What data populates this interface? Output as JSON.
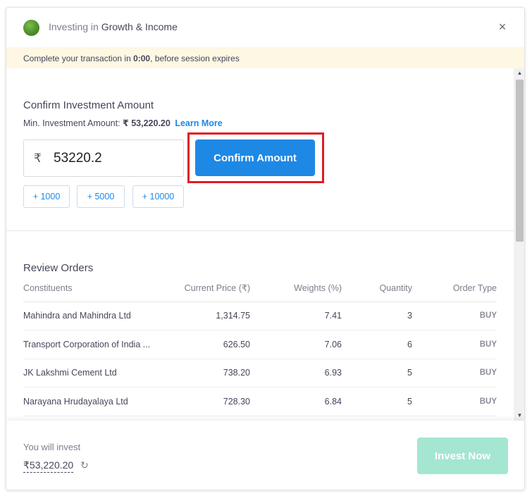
{
  "header": {
    "title_prefix": "Investing in",
    "title_name": "Growth & Income",
    "close_symbol": "×"
  },
  "banner": {
    "text_before": "Complete your transaction in ",
    "time": "0:00",
    "text_after": ", before session expires"
  },
  "confirm": {
    "title": "Confirm Investment Amount",
    "min_label": "Min. Investment Amount: ",
    "min_amount": "₹ 53,220.20",
    "learn_more": "Learn More",
    "currency_symbol": "₹",
    "amount_value": "53220.2",
    "button_label": "Confirm Amount",
    "chips": [
      "+ 1000",
      "+ 5000",
      "+ 10000"
    ]
  },
  "review": {
    "title": "Review Orders",
    "columns": [
      "Constituents",
      "Current Price (₹)",
      "Weights (%)",
      "Quantity",
      "Order Type"
    ],
    "rows": [
      [
        "Mahindra and Mahindra Ltd",
        "1,314.75",
        "7.41",
        "3",
        "BUY"
      ],
      [
        "Transport Corporation of India ...",
        "626.50",
        "7.06",
        "6",
        "BUY"
      ],
      [
        "JK Lakshmi Cement Ltd",
        "738.20",
        "6.93",
        "5",
        "BUY"
      ],
      [
        "Narayana Hrudayalaya Ltd",
        "728.30",
        "6.84",
        "5",
        "BUY"
      ]
    ]
  },
  "footer": {
    "invest_label": "You will invest",
    "invest_amount": "₹53,220.20",
    "invest_button": "Invest Now"
  },
  "colors": {
    "primary": "#1e88e5",
    "highlight": "#e01b24",
    "invest_button_disabled": "#a4e6d1",
    "banner_bg": "#fdf7e3"
  },
  "icons": {
    "logo": "portfolio-logo-icon",
    "close": "close-icon",
    "refresh": "refresh-icon"
  }
}
